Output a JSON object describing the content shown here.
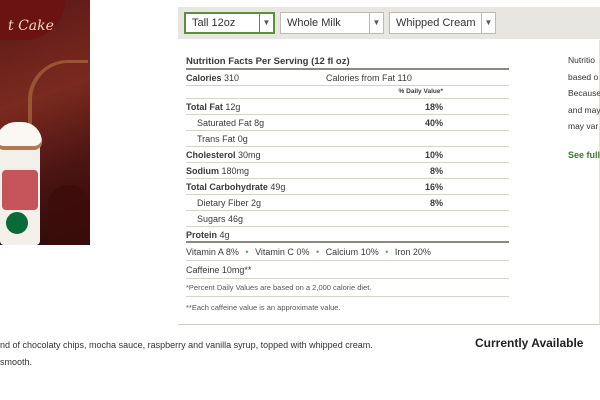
{
  "hero": {
    "banner_text": "t Cake",
    "image": "starbucks-frappuccino-drink-photo"
  },
  "selectors": {
    "size": "Tall 12oz",
    "milk": "Whole Milk",
    "topping": "Whipped Cream",
    "accent_color": "#5a8f3c"
  },
  "nutrition": {
    "title": "Nutrition Facts Per Serving (12 fl oz)",
    "calories_label": "Calories",
    "calories_value": "310",
    "calories_fat_label": "Calories from Fat",
    "calories_fat_value": "110",
    "daily_value_header": "% Daily Value*",
    "rows": [
      {
        "label": "Total Fat",
        "amount": "12g",
        "pct": "18%"
      },
      {
        "label": "Saturated Fat",
        "amount": "8g",
        "pct": "40%"
      },
      {
        "label": "Trans Fat",
        "amount": "0g",
        "pct": ""
      },
      {
        "label": "Cholesterol",
        "amount": "30mg",
        "pct": "10%"
      },
      {
        "label": "Sodium",
        "amount": "180mg",
        "pct": "8%"
      },
      {
        "label": "Total Carbohydrate",
        "amount": "49g",
        "pct": "16%"
      },
      {
        "label": "Dietary Fiber",
        "amount": "2g",
        "pct": "8%"
      },
      {
        "label": "Sugars",
        "amount": "46g",
        "pct": ""
      },
      {
        "label": "Protein",
        "amount": "4g",
        "pct": ""
      }
    ],
    "vitamins": [
      {
        "label": "Vitamin A",
        "value": "8%"
      },
      {
        "label": "Vitamin C",
        "value": "0%"
      },
      {
        "label": "Calcium",
        "value": "10%"
      },
      {
        "label": "Iron",
        "value": "20%"
      }
    ],
    "caffeine": "Caffeine 10mg**",
    "footnote_daily": "*Percent Daily Values are based on a 2,000 calorie diet.",
    "footnote_caffeine": "**Each caffeine value is an approximate value."
  },
  "side": {
    "lines": [
      "Nutritio",
      "based o",
      "Because",
      "and may",
      "may var"
    ],
    "see_full": "See full"
  },
  "description": {
    "line1": "nd of chocolaty chips, mocha sauce, raspberry and vanilla syrup, topped with whipped cream.",
    "line2": "smooth."
  },
  "availability": "Currently Available"
}
